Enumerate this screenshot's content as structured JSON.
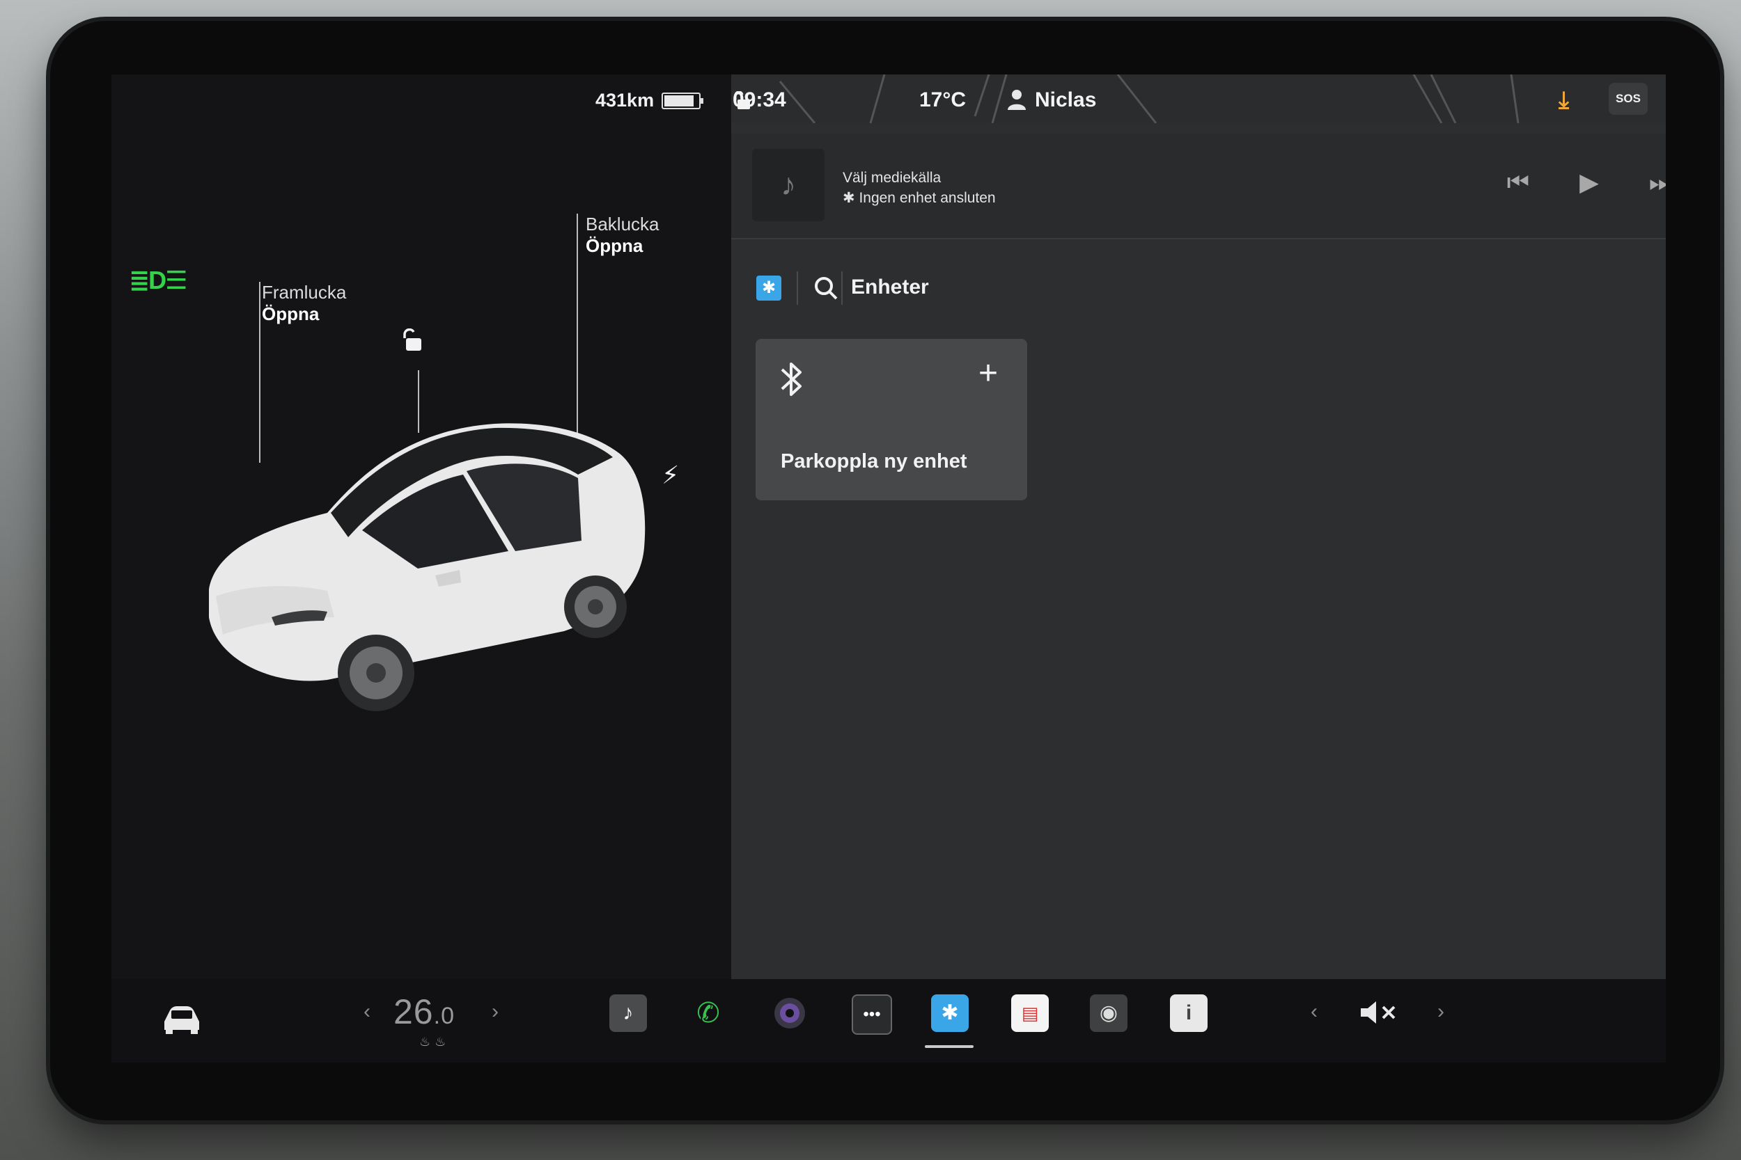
{
  "status": {
    "range": "431km",
    "time": "09:34",
    "temperature": "17°C",
    "driver": "Niclas",
    "sos": "SOS"
  },
  "car": {
    "frunk_label": "Framlucka",
    "frunk_action": "Öppna",
    "trunk_label": "Baklucka",
    "trunk_action": "Öppna"
  },
  "media": {
    "source": "Välj mediekälla",
    "device": "Ingen enhet ansluten"
  },
  "bluetooth": {
    "tab_label": "Enheter",
    "pair_label": "Parkoppla ny enhet"
  },
  "dock": {
    "temperature": "26.0",
    "temp_int": "26",
    "temp_dec": ".0"
  },
  "colors": {
    "accent_blue": "#3aa6e8",
    "headlight_green": "#35d24b",
    "download_orange": "#f0a63a"
  }
}
